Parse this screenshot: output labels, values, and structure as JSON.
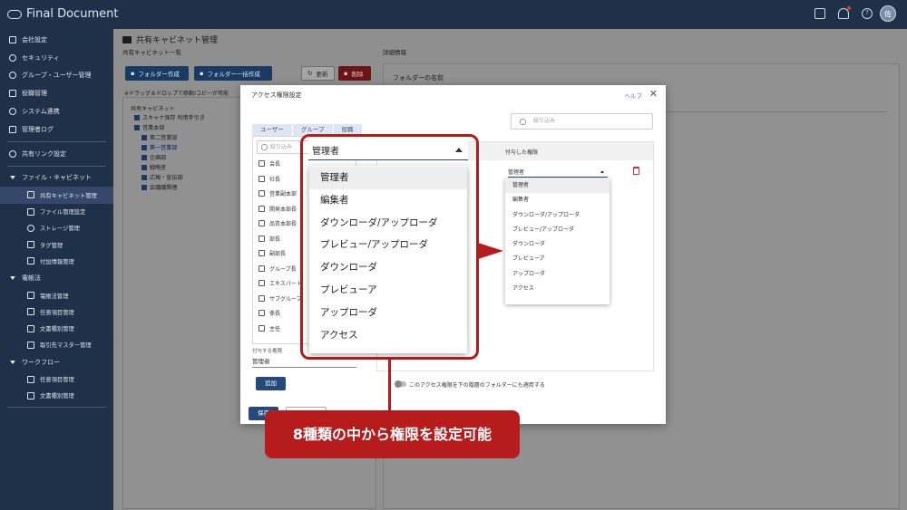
{
  "app": {
    "logo_text": "Final Document",
    "avatar_text": "佐"
  },
  "sidebar": {
    "items": [
      {
        "label": "会社設定"
      },
      {
        "label": "セキュリティ"
      },
      {
        "label": "グループ・ユーザー管理"
      },
      {
        "label": "役職管理"
      },
      {
        "label": "システム連携"
      },
      {
        "label": "管理者ログ"
      },
      {
        "label": "共有リンク設定"
      },
      {
        "label": "ファイル・キャビネット"
      },
      {
        "label": "共有キャビネット管理"
      },
      {
        "label": "ファイル管理設定"
      },
      {
        "label": "ストレージ管理"
      },
      {
        "label": "タグ管理"
      },
      {
        "label": "付加情報管理"
      },
      {
        "label": "電帳法"
      },
      {
        "label": "電帳法管理"
      },
      {
        "label": "任意項目管理"
      },
      {
        "label": "文書種別管理"
      },
      {
        "label": "取引先マスター管理"
      },
      {
        "label": "ワークフロー"
      },
      {
        "label": "任意項目管理"
      },
      {
        "label": "文書種別管理"
      }
    ]
  },
  "main": {
    "title": "共有キャビネット管理",
    "list_title": "共有キャビネット一覧",
    "create_folder": "フォルダー作成",
    "bulk_create": "フォルダー一括作成",
    "refresh": "更新",
    "delete": "削除",
    "dd_note": "※ドラッグ＆ドロップで移動/コピーが可能",
    "tree": [
      "共有キャビネット",
      "スキャナ保存 利用手引き",
      "営業本部",
      "第二営業部",
      "第一営業部",
      "企画部",
      "戦略室",
      "広報・宣伝部",
      "会議議関連"
    ],
    "detail_title": "詳細情報",
    "folder_name_label": "フォルダーの名前"
  },
  "modal": {
    "title": "アクセス権限設定",
    "help": "ヘルプ",
    "tabs": [
      "ユーザー",
      "グループ",
      "役職"
    ],
    "list_search_placeholder": "絞り込み",
    "roles": [
      "会長",
      "社長",
      "営業副本部",
      "開発本部長",
      "品質本部長",
      "部長",
      "副部長",
      "グループ長",
      "エキスパート",
      "サブグループ",
      "係長",
      "主任"
    ],
    "grant_label": "付与する権限",
    "grant_value": "管理者",
    "add_button": "追加",
    "save_button": "保存",
    "right_search_placeholder": "絞り込み",
    "granted_header": "付与した権限",
    "granted_value": "管理者",
    "apply_children": "このアクセス権限を下の階層のフォルダーにも適用する",
    "permission_options": [
      "管理者",
      "編集者",
      "ダウンローダ/アップローダ",
      "プレビュー/アップローダ",
      "ダウンローダ",
      "プレビューア",
      "アップローダ",
      "アクセス"
    ]
  },
  "zoom": {
    "selected": "管理者",
    "options": [
      "管理者",
      "編集者",
      "ダウンローダ/アップローダ",
      "プレビュー/アップローダ",
      "ダウンローダ",
      "プレビューア",
      "アップローダ",
      "アクセス"
    ]
  },
  "callout_text": "8種類の中から権限を設定可能",
  "colors": {
    "navy": "#1f3149",
    "accent": "#234a78",
    "callout_red": "#b71c1c"
  }
}
